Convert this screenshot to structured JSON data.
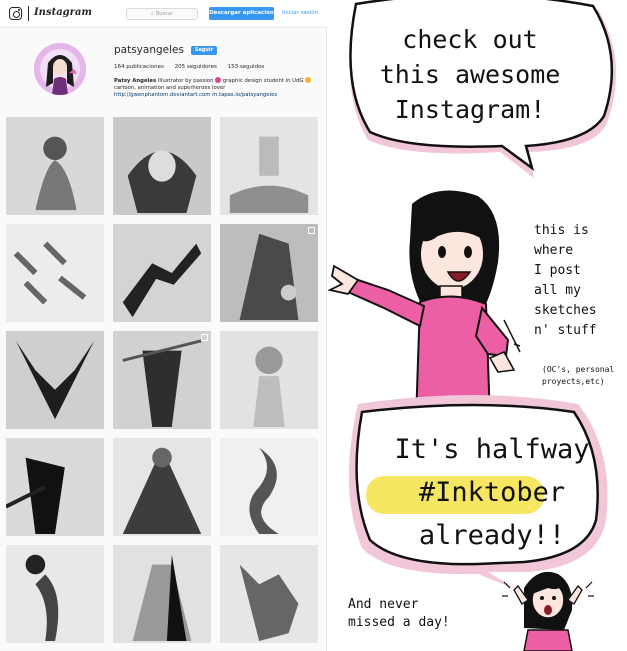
{
  "topbar": {
    "logo_icon": "instagram-camera-icon",
    "wordmark": "Instagram",
    "search_placeholder": "Buscar",
    "download_label": "Descargar aplicación",
    "login_label": "Iniciar sesión"
  },
  "profile": {
    "username": "patsyangeles",
    "follow_label": "Seguir",
    "stats": {
      "posts": "164 publicaciones",
      "followers": "205 seguidores",
      "following": "153 seguidos"
    },
    "bio_name": "Patsy Angeles",
    "bio_line1": "Illustrator by passion",
    "bio_line1b": "graphic design student in UdG",
    "bio_line2": "cartoon, animation and superheroes lover",
    "bio_link1": "http://gwenphantom.deviantart.com",
    "bio_link2": "m.tapas.io/patsyangeles"
  },
  "posts": [
    {
      "name": "post-1",
      "multi": false
    },
    {
      "name": "post-2",
      "multi": false
    },
    {
      "name": "post-3",
      "multi": false
    },
    {
      "name": "post-4",
      "multi": false
    },
    {
      "name": "post-5",
      "multi": false
    },
    {
      "name": "post-6",
      "multi": true
    },
    {
      "name": "post-7",
      "multi": false
    },
    {
      "name": "post-8",
      "multi": true
    },
    {
      "name": "post-9",
      "multi": false
    },
    {
      "name": "post-10",
      "multi": false
    },
    {
      "name": "post-11",
      "multi": false
    },
    {
      "name": "post-12",
      "multi": false
    },
    {
      "name": "post-13",
      "multi": false
    },
    {
      "name": "post-14",
      "multi": false
    },
    {
      "name": "post-15",
      "multi": false
    }
  ],
  "comic": {
    "bubble1_line1": "check out",
    "bubble1_line2": "this awesome",
    "bubble1_line3": "Instagram!",
    "side_line1": "this is",
    "side_line2": "where",
    "side_line3": "I post",
    "side_line4": "all my",
    "side_line5": "sketches",
    "side_line6": "n' stuff",
    "small_line1": "(OC's, personal",
    "small_line2": "proyects,etc)",
    "bubble2_line1": "It's halfway",
    "bubble2_line2": "#Inktober",
    "bubble2_line3": "already!!",
    "bottom_line1": "And never",
    "bottom_line2": "missed a day!"
  },
  "colors": {
    "accent_blue": "#3897f0",
    "bubble_pink": "#f0c6d8",
    "shirt_pink": "#ec5fa5",
    "highlight_yellow": "#f7e661"
  }
}
